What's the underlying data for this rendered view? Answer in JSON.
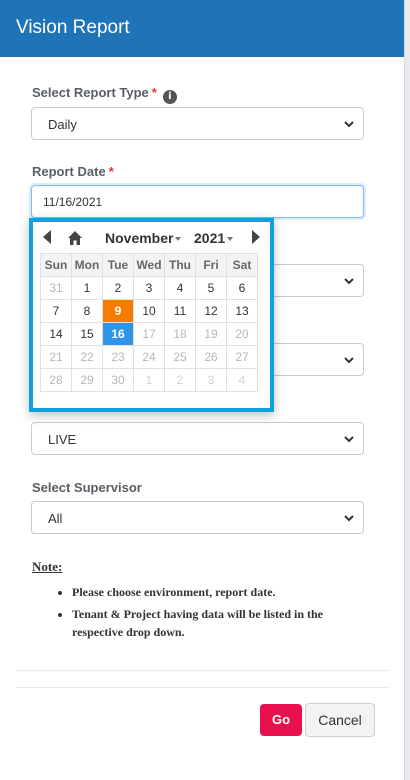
{
  "header": {
    "title": "Vision Report"
  },
  "fields": {
    "report_type": {
      "label": "Select Report Type",
      "required": "*",
      "info_icon": "i",
      "value": "Daily"
    },
    "report_date": {
      "label": "Report Date",
      "required": "*",
      "value": "11/16/2021"
    },
    "environment": {
      "value": "LIVE"
    },
    "supervisor": {
      "label": "Select Supervisor",
      "value": "All"
    }
  },
  "calendar": {
    "month": "November",
    "year": "2021",
    "weekdays": [
      "Sun",
      "Mon",
      "Tue",
      "Wed",
      "Thu",
      "Fri",
      "Sat"
    ],
    "weeks": [
      [
        "31",
        "1",
        "2",
        "3",
        "4",
        "5",
        "6"
      ],
      [
        "7",
        "8",
        "9",
        "10",
        "11",
        "12",
        "13"
      ],
      [
        "14",
        "15",
        "16",
        "17",
        "18",
        "19",
        "20"
      ],
      [
        "21",
        "22",
        "23",
        "24",
        "25",
        "26",
        "27"
      ],
      [
        "28",
        "29",
        "30",
        "1",
        "2",
        "3",
        "4"
      ]
    ],
    "today": "9",
    "selected": "16"
  },
  "note": {
    "title": "Note:",
    "items": [
      "Please choose environment, report date.",
      "Tenant & Project having data will be listed in the respective drop down."
    ]
  },
  "buttons": {
    "go": "Go",
    "cancel": "Cancel"
  },
  "colors": {
    "header": "#1f73b7",
    "go_button": "#e8104f",
    "today": "#f57c00",
    "selected": "#2e95e8",
    "calendar_border": "#10a0e0"
  }
}
